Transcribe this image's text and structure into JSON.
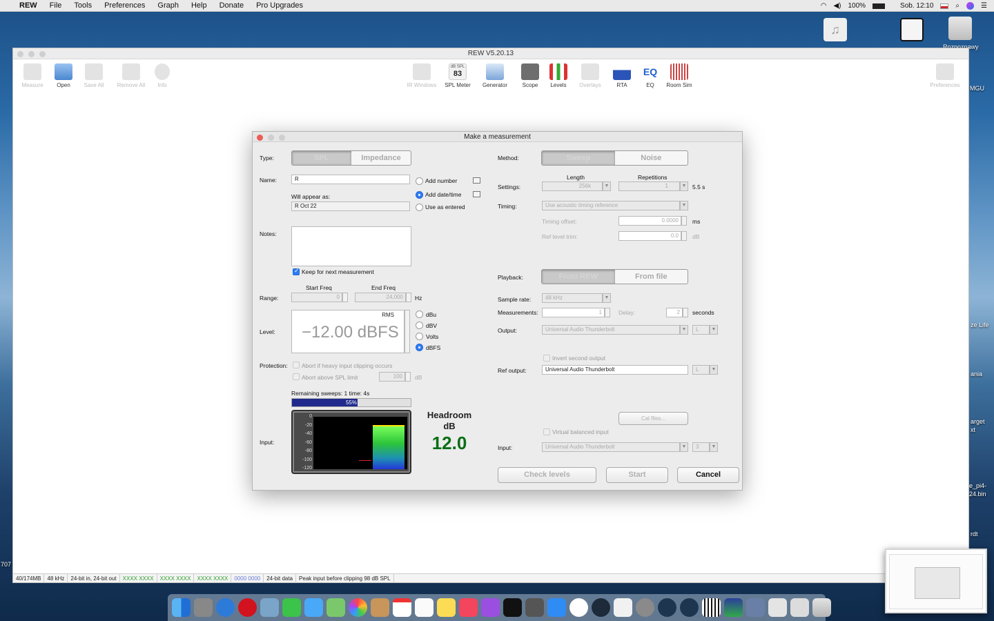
{
  "menubar": {
    "app": "REW",
    "items": [
      "File",
      "Tools",
      "Preferences",
      "Graph",
      "Help",
      "Donate",
      "Pro Upgrades"
    ],
    "battery": "100%",
    "clock": "Sob. 12:10"
  },
  "desktop": {
    "labels": [
      "Rozpoznawy",
      "MGU",
      "ze Life",
      "ania",
      "arget",
      "xt",
      "e_pi4-",
      "24.bin",
      "rdt",
      "707"
    ]
  },
  "rew": {
    "title": "REW V5.20.13",
    "toolbar_left": [
      "Measure",
      "Open",
      "Save All",
      "Remove All",
      "Info"
    ],
    "toolbar_center": [
      "IR Windows",
      "SPL Meter",
      "Generator",
      "Scope",
      "Levels",
      "Overlays",
      "RTA",
      "EQ",
      "Room Sim"
    ],
    "toolbar_right": "Preferences",
    "spl_meter_unit": "dB SPL",
    "spl_meter_value": "83",
    "status": [
      "40/174MB",
      "48 kHz",
      "24-bit in, 24-bit out",
      "XXXX XXXX",
      "XXXX XXXX",
      "XXXX XXXX",
      "0000 0000",
      "24-bit data",
      "Peak input before clipping 98 dB SPL"
    ]
  },
  "dialog": {
    "title": "Make a measurement",
    "type_label": "Type:",
    "type_options": [
      "SPL",
      "Impedance"
    ],
    "name_label": "Name:",
    "name_value": "R",
    "name_options": [
      "Add number",
      "Add date/time",
      "Use as entered"
    ],
    "appear_label": "Will appear as:",
    "appear_value": "R Oct 22",
    "notes_label": "Notes:",
    "keep_label": "Keep for next measurement",
    "range_label": "Range:",
    "start_freq_label": "Start Freq",
    "end_freq_label": "End Freq",
    "start_freq": "0",
    "end_freq": "24,000",
    "hz": "Hz",
    "level_label": "Level:",
    "rms": "RMS",
    "level_value": "−12.00 dBFS",
    "level_units": [
      "dBu",
      "dBV",
      "Volts",
      "dBFS"
    ],
    "protection_label": "Protection:",
    "abort_clip": "Abort if heavy input clipping occurs",
    "abort_spl": "Abort above SPL limit",
    "spl_limit": "100",
    "db": "dB",
    "remaining": "Remaining sweeps: 1   time: 4s",
    "progress_text": "55%",
    "progress": 0.55,
    "input_label": "Input:",
    "meter_ticks": [
      "0",
      "-20",
      "-40",
      "-60",
      "-80",
      "-100",
      "-120"
    ],
    "headroom_title": "Headroom",
    "headroom_unit": "dB",
    "headroom_value": "12.0",
    "method_label": "Method:",
    "method_options": [
      "Sweep",
      "Noise"
    ],
    "length_label": "Length",
    "repetitions_label": "Repetitions",
    "settings_label": "Settings:",
    "length_value": "256k",
    "repetitions_value": "1",
    "duration": "5.5 s",
    "timing_label": "Timing:",
    "timing_value": "Use acoustic timing reference",
    "timing_offset_label": "Timing offset:",
    "timing_offset": "0.0000",
    "ms": "ms",
    "ref_trim_label": "Ref level trim:",
    "ref_trim": "0.0",
    "playback_label": "Playback:",
    "playback_options": [
      "From REW",
      "From file"
    ],
    "sample_rate_label": "Sample rate:",
    "sample_rate": "48 kHz",
    "measurements_label": "Measurements:",
    "measurements": "1",
    "delay_label": "Delay:",
    "delay": "2",
    "seconds": "seconds",
    "output_label": "Output:",
    "output_device": "Universal Audio Thunderbolt",
    "output_channel": "L",
    "invert_label": "Invert second output",
    "ref_output_label": "Ref output:",
    "ref_output_device": "Universal Audio Thunderbolt",
    "ref_output_channel": "L",
    "cal_files": "Cal files...",
    "virtual_label": "Virtual balanced input",
    "input_device_label": "Input:",
    "input_device": "Universal Audio Thunderbolt",
    "input_channel": "3",
    "btn_check": "Check levels",
    "btn_start": "Start",
    "btn_cancel": "Cancel"
  },
  "colors": {
    "accent": "#2e7cf6",
    "headroom": "#0a6e14",
    "progress": "#1f2a8c"
  }
}
